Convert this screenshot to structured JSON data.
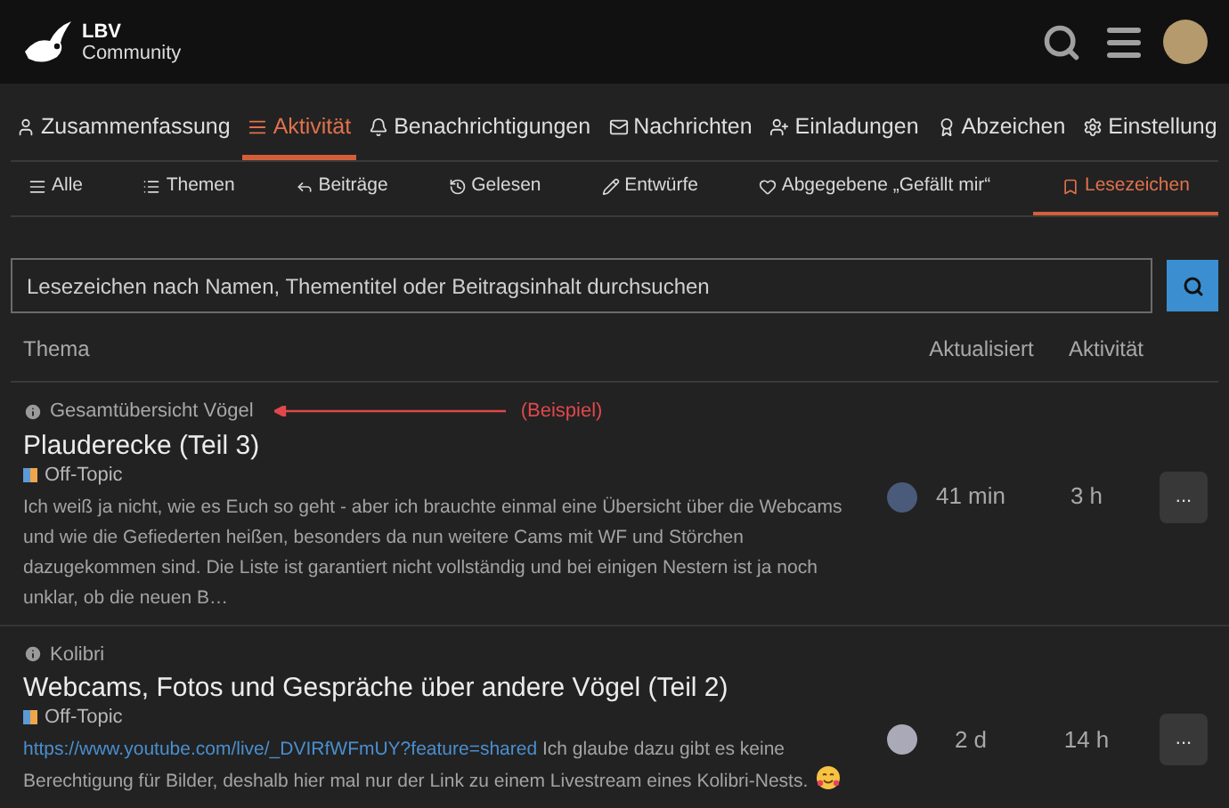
{
  "header": {
    "logo_title": "LBV",
    "logo_subtitle": "Community"
  },
  "user_tabs": [
    {
      "label": "Zusammenfassung",
      "selected": false
    },
    {
      "label": "Aktivität",
      "selected": true
    },
    {
      "label": "Benachrichtigungen",
      "selected": false
    },
    {
      "label": "Nachrichten",
      "selected": false
    },
    {
      "label": "Einladungen",
      "selected": false
    },
    {
      "label": "Abzeichen",
      "selected": false
    },
    {
      "label": "Einstellung",
      "selected": false
    }
  ],
  "activity_tabs": [
    {
      "label": "Alle",
      "selected": false
    },
    {
      "label": "Themen",
      "selected": false
    },
    {
      "label": "Beiträge",
      "selected": false
    },
    {
      "label": "Gelesen",
      "selected": false
    },
    {
      "label": "Entwürfe",
      "selected": false
    },
    {
      "label": "Abgegebene „Gefällt mir“",
      "selected": false
    },
    {
      "label": "Lesezeichen",
      "selected": true
    }
  ],
  "search": {
    "placeholder": "Lesezeichen nach Namen, Thementitel oder Beitragsinhalt durchsuchen"
  },
  "table": {
    "columns": [
      "Thema",
      "Aktualisiert",
      "Aktivität"
    ],
    "rows": [
      {
        "context": "Gesamtübersicht Vögel",
        "annotation": "(Beispiel)",
        "title": "Plauderecke (Teil 3)",
        "category": "Off-Topic",
        "excerpt": "Ich weiß ja nicht, wie es Euch so geht - aber ich brauchte einmal eine Übersicht über die Webcams und wie die Gefiederten heißen, besonders da nun weitere Cams mit WF und Störchen dazugekommen sind. Die Liste ist garantiert nicht vollständig und bei einigen Nestern ist ja noch unklar, ob die neuen B…",
        "updated": "41 min",
        "activity": "3 h",
        "menu": "..."
      },
      {
        "context": "Kolibri",
        "title": "Webcams, Fotos und Gespräche über andere Vögel (Teil 2)",
        "category": "Off-Topic",
        "link": "https://www.youtube.com/live/_DVIRfWFmUY?feature=shared",
        "excerpt": "Ich glaube dazu gibt es keine Berechtigung für Bilder, deshalb hier mal nur der Link zu einem Livestream eines Kolibri-Nests.",
        "emoji": true,
        "updated": "2 d",
        "activity": "14 h",
        "menu": "..."
      }
    ]
  }
}
